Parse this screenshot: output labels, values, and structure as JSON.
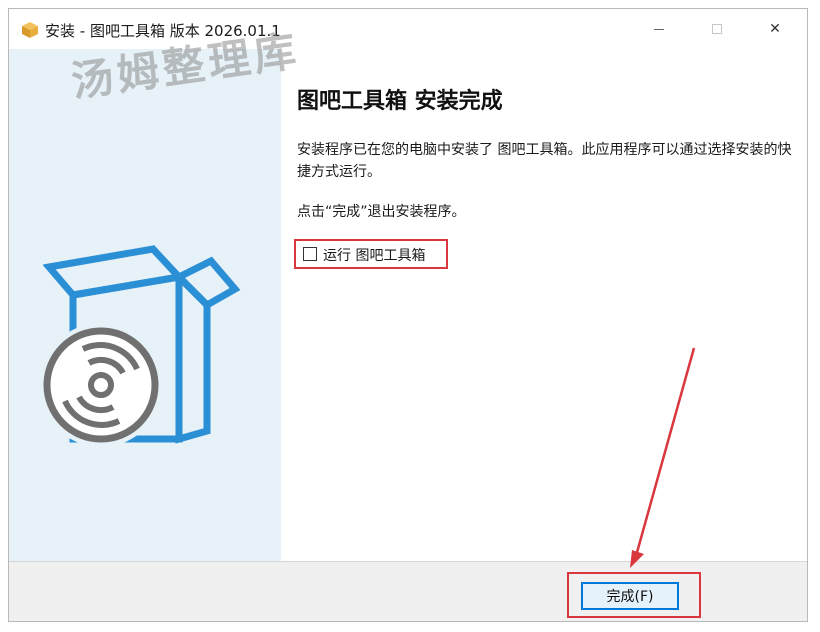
{
  "window": {
    "title": "安装 - 图吧工具箱 版本 2026.01.1",
    "controls": [
      "minimize",
      "maximize",
      "close"
    ],
    "close_glyph": "✕"
  },
  "watermark": "汤姆整理库",
  "content": {
    "heading": "图吧工具箱 安装完成",
    "message": "安装程序已在您的电脑中安装了 图吧工具箱。此应用程序可以通过选择安装的快捷方式运行。",
    "exit_message": "点击“完成”退出安装程序。",
    "run_checkbox": {
      "label": "运行 图吧工具箱",
      "checked": false
    }
  },
  "footer": {
    "finish_label": "完成(F)"
  },
  "colors": {
    "accent": "#0078d7",
    "highlight_red": "#d9363e",
    "side_panel": "#e6f1f8",
    "box_blue": "#2b8fd6"
  }
}
